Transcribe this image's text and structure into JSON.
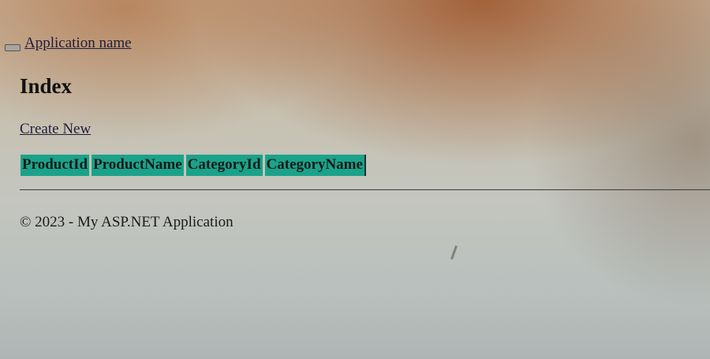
{
  "navbar": {
    "toggle_icon": "hamburger-icon",
    "brand": "Application name"
  },
  "main": {
    "title": "Index",
    "create_link": "Create New",
    "table": {
      "headers": [
        "ProductId",
        "ProductName",
        "CategoryId",
        "CategoryName"
      ],
      "header_color": "#1aa38a"
    }
  },
  "footer": {
    "text": "© 2023 - My ASP.NET Application"
  }
}
